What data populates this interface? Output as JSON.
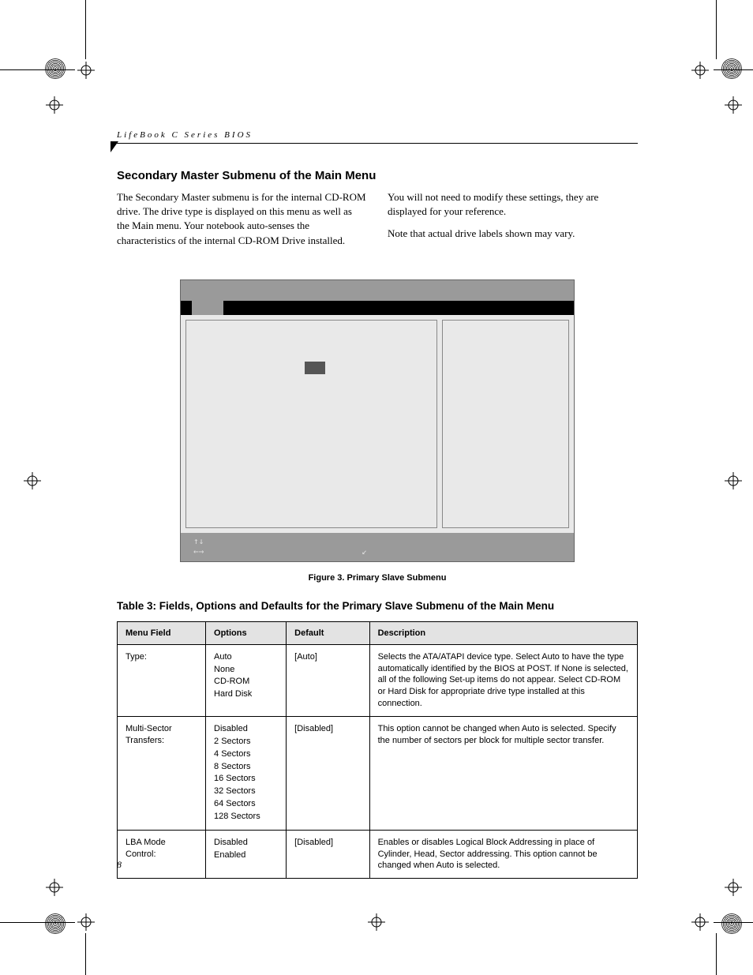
{
  "running_header": "LifeBook C Series BIOS",
  "section_title": "Secondary Master Submenu of the Main Menu",
  "col1": {
    "p1": "The Secondary Master submenu is for the internal CD-ROM drive. The drive type is displayed on this menu as well as the Main menu. Your notebook auto-senses the characteristics of the internal CD-ROM Drive installed."
  },
  "col2": {
    "p1": "You will not need to modify these settings, they are displayed for your reference.",
    "p2": "Note that actual drive labels shown may vary."
  },
  "bios_foot": {
    "l1a": "↑↓",
    "l2a": "←→",
    "l2b": "↙"
  },
  "figure_caption": "Figure 3.  Primary Slave Submenu",
  "table_title": "Table 3: Fields, Options and Defaults for the Primary Slave Submenu of the Main Menu",
  "headers": {
    "menu": "Menu Field",
    "options": "Options",
    "default": "Default",
    "description": "Description"
  },
  "rows": [
    {
      "menu": "Type:",
      "options": [
        "Auto",
        "None",
        "CD-ROM",
        "Hard Disk"
      ],
      "default": "[Auto]",
      "description": "Selects the ATA/ATAPI device type. Select Auto to have the type automatically identified by the BIOS at POST. If None is selected, all of the following Set-up items do not appear. Select CD-ROM or Hard Disk for appropriate drive type installed at this connection."
    },
    {
      "menu": "Multi-Sector Transfers:",
      "options": [
        "Disabled",
        "2 Sectors",
        "4 Sectors",
        "8 Sectors",
        "16 Sectors",
        "32 Sectors",
        "64 Sectors",
        "128 Sectors"
      ],
      "default": "[Disabled]",
      "description": "This option cannot be changed when Auto is selected. Specify the number of sectors per block for multiple sector transfer."
    },
    {
      "menu": "LBA Mode Control:",
      "options": [
        "Disabled",
        "Enabled"
      ],
      "default": "[Disabled]",
      "description": "Enables or disables Logical Block Addressing in place of Cylinder, Head, Sector addressing. This option cannot be changed when Auto is selected."
    }
  ],
  "page_number": "8"
}
